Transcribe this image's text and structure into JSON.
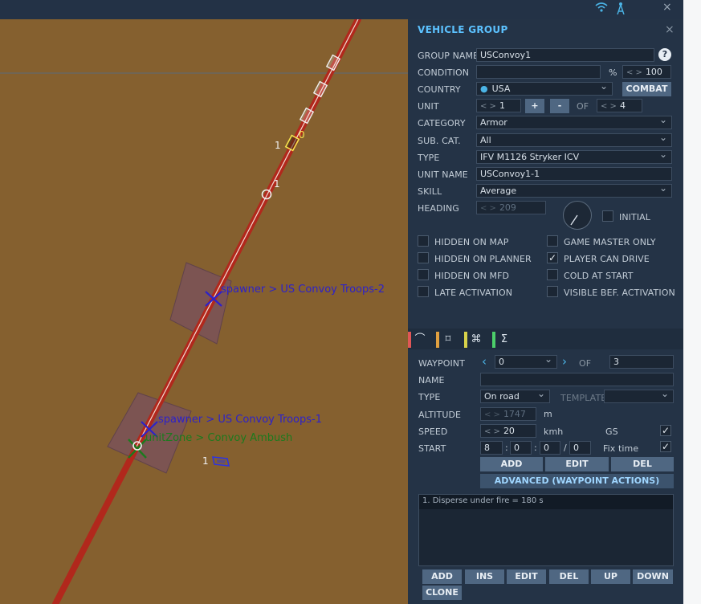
{
  "topbar": {
    "wifi_icon": "wifi-icon",
    "antenna_icon": "antenna-icon",
    "close": "×"
  },
  "map": {
    "labels": {
      "spawner2": "spawner > US Convoy Troops-2",
      "spawner1": "spawner > US Convoy Troops-1",
      "unitzone": "unitZone > Convoy Ambush"
    },
    "wp_numbers": {
      "a": "1",
      "b": "0",
      "c": "1",
      "d": "1"
    },
    "colors": {
      "terrain": "#85602f",
      "route": "#b1281c",
      "spawner": "#2d22c9",
      "zone": "#1c7a1e"
    }
  },
  "panel": {
    "title": "VEHICLE GROUP",
    "close": "×",
    "group_name": {
      "label": "GROUP NAME",
      "value": "USConvoy1",
      "help": "?"
    },
    "condition": {
      "label": "CONDITION",
      "value": "",
      "pct": "%",
      "value2": "100"
    },
    "country": {
      "label": "COUNTRY",
      "value": "USA",
      "button": "COMBAT"
    },
    "unit": {
      "label": "UNIT",
      "value": "1",
      "plus": "+",
      "minus": "-",
      "of": "OF",
      "total": "4"
    },
    "category": {
      "label": "CATEGORY",
      "value": "Armor"
    },
    "subcat": {
      "label": "SUB. CAT.",
      "value": "All"
    },
    "type": {
      "label": "TYPE",
      "value": "IFV M1126 Stryker ICV"
    },
    "unit_name": {
      "label": "UNIT NAME",
      "value": "USConvoy1-1"
    },
    "skill": {
      "label": "SKILL",
      "value": "Average"
    },
    "heading": {
      "label": "HEADING",
      "value": "209",
      "initial": "INITIAL"
    },
    "checks": {
      "hidden_map": {
        "label": "HIDDEN ON MAP",
        "checked": false
      },
      "hidden_planner": {
        "label": "HIDDEN ON PLANNER",
        "checked": false
      },
      "hidden_mfd": {
        "label": "HIDDEN ON MFD",
        "checked": false
      },
      "late_activation": {
        "label": "LATE ACTIVATION",
        "checked": false
      },
      "gm_only": {
        "label": "GAME MASTER ONLY",
        "checked": false
      },
      "player_drive": {
        "label": "PLAYER CAN DRIVE",
        "checked": true,
        "mark": "✓"
      },
      "cold_start": {
        "label": "COLD AT START",
        "checked": false
      },
      "visible_bef": {
        "label": "VISIBLE BEF. ACTIVATION",
        "checked": false
      }
    },
    "tabs": {
      "route": "⌒",
      "triggers": "⌑",
      "payload": "⌘",
      "summary": "Σ"
    },
    "tab_colors": [
      "#e05757",
      "#e0a040",
      "#d7d24a",
      "#4ccf6a"
    ],
    "waypoint": {
      "label": "WAYPOINT",
      "value": "0",
      "of": "OF",
      "total": "3",
      "name_label": "NAME",
      "name_value": "",
      "type_label": "TYPE",
      "type_value": "On road",
      "template_label": "TEMPLATE",
      "template_value": "",
      "altitude_label": "ALTITUDE",
      "altitude_value": "1747",
      "altitude_unit": "m",
      "speed_label": "SPEED",
      "speed_value": "20",
      "speed_unit": "kmh",
      "gs": "GS",
      "gs_mark": "✓",
      "start_label": "START",
      "h": "8",
      "m": "0",
      "s": "0",
      "d": "0",
      "fix_time": "Fix time",
      "fix_mark": "✓",
      "add": "ADD",
      "edit": "EDIT",
      "del": "DEL",
      "advanced": "ADVANCED (WAYPOINT ACTIONS)"
    },
    "actions": [
      "1. Disperse under fire = 180 s"
    ],
    "bottom_buttons": {
      "add": "ADD",
      "ins": "INS",
      "edit": "EDIT",
      "del": "DEL",
      "up": "UP",
      "down": "DOWN",
      "clone": "CLONE"
    }
  }
}
